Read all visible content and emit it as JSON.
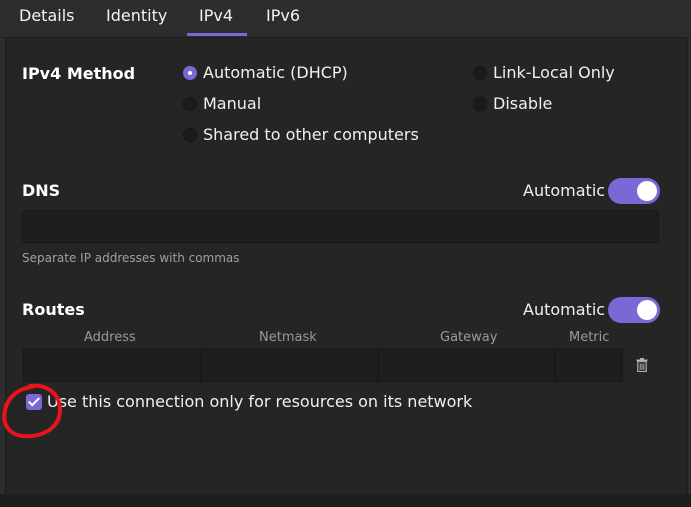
{
  "tabs": [
    {
      "label": "Details"
    },
    {
      "label": "Identity"
    },
    {
      "label": "IPv4"
    },
    {
      "label": "IPv6"
    }
  ],
  "active_tab": "IPv4",
  "ipv4": {
    "method_heading": "IPv4 Method",
    "options": [
      {
        "label": "Automatic (DHCP)",
        "selected": true
      },
      {
        "label": "Manual",
        "selected": false
      },
      {
        "label": "Shared to other computers",
        "selected": false
      },
      {
        "label": "Link-Local Only",
        "selected": false
      },
      {
        "label": "Disable",
        "selected": false
      }
    ]
  },
  "dns": {
    "heading": "DNS",
    "automatic_label": "Automatic",
    "automatic_on": true,
    "value": "",
    "hint": "Separate IP addresses with commas"
  },
  "routes": {
    "heading": "Routes",
    "automatic_label": "Automatic",
    "automatic_on": true,
    "columns": [
      "Address",
      "Netmask",
      "Gateway",
      "Metric"
    ]
  },
  "resources_checkbox": {
    "label": "Use this connection only for resources on its network",
    "checked": true
  },
  "colors": {
    "accent": "#7b68d6",
    "annotation": "#e8141c"
  },
  "icons": {
    "delete": "trash-icon"
  }
}
